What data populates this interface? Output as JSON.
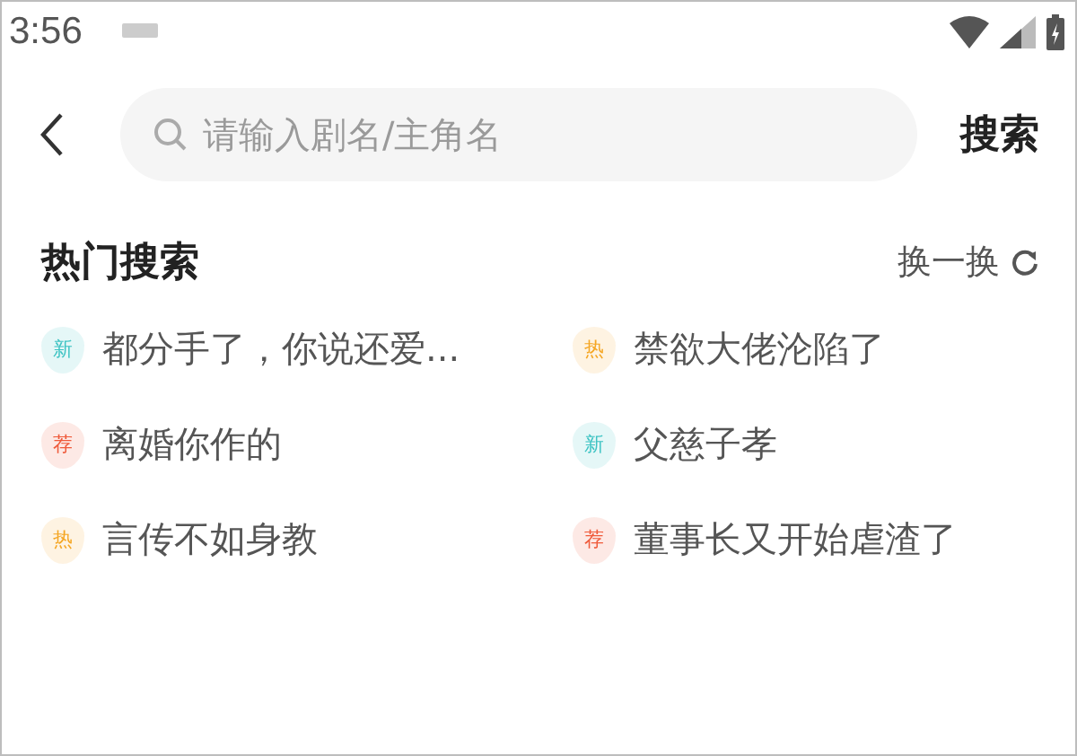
{
  "status_bar": {
    "time": "3:56"
  },
  "search_bar": {
    "placeholder": "请输入剧名/主角名",
    "button": "搜索"
  },
  "hot_search": {
    "title": "热门搜索",
    "refresh": "换一换",
    "items": [
      {
        "badge": "新",
        "color": "#3cc3c3",
        "text": "都分手了，你说还爱..."
      },
      {
        "badge": "热",
        "color": "#f5a623",
        "text": "禁欲大佬沦陷了"
      },
      {
        "badge": "荐",
        "color": "#ef5a3a",
        "text": "离婚你作的"
      },
      {
        "badge": "新",
        "color": "#3cc3c3",
        "text": "父慈子孝"
      },
      {
        "badge": "热",
        "color": "#f5a623",
        "text": "言传不如身教"
      },
      {
        "badge": "荐",
        "color": "#ef5a3a",
        "text": "董事长又开始虐渣了"
      }
    ]
  }
}
